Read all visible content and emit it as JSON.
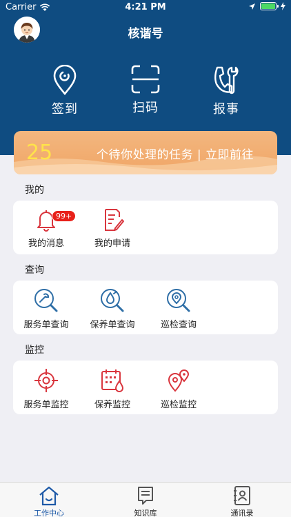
{
  "status_bar": {
    "carrier": "Carrier",
    "time": "4:21 PM"
  },
  "header": {
    "title": "核谐号"
  },
  "quick_actions": [
    {
      "label": "签到",
      "icon": "location-checkin-icon"
    },
    {
      "label": "扫码",
      "icon": "scan-frame-icon"
    },
    {
      "label": "报事",
      "icon": "phone-wrench-icon"
    }
  ],
  "task_banner": {
    "count": "25",
    "text": "个待你处理的任务 | 立即前往"
  },
  "sections": {
    "mine": {
      "title": "我的",
      "items": [
        {
          "label": "我的消息",
          "badge": "99+",
          "icon": "bell-icon"
        },
        {
          "label": "我的申请",
          "icon": "document-edit-icon"
        }
      ]
    },
    "query": {
      "title": "查询",
      "items": [
        {
          "label": "服务单查询",
          "icon": "service-search-icon"
        },
        {
          "label": "保养单查询",
          "icon": "maintenance-search-icon"
        },
        {
          "label": "巡检查询",
          "icon": "inspection-search-icon"
        }
      ]
    },
    "monitor": {
      "title": "监控",
      "items": [
        {
          "label": "服务单监控",
          "icon": "target-icon"
        },
        {
          "label": "保养监控",
          "icon": "calendar-drop-icon"
        },
        {
          "label": "巡检监控",
          "icon": "map-pins-icon"
        }
      ]
    }
  },
  "tabbar": {
    "items": [
      {
        "label": "工作中心",
        "active": true,
        "icon": "home-icon"
      },
      {
        "label": "知识库",
        "active": false,
        "icon": "book-chat-icon"
      },
      {
        "label": "通讯录",
        "active": false,
        "icon": "contacts-book-icon"
      }
    ]
  },
  "colors": {
    "header_bg": "#0f4c81",
    "banner": "#f0a566",
    "count": "#ffe34a",
    "icon_blue": "#2e6ea6",
    "icon_red": "#d9363e",
    "badge": "#e8211a",
    "tab_active": "#1e5aa8"
  }
}
